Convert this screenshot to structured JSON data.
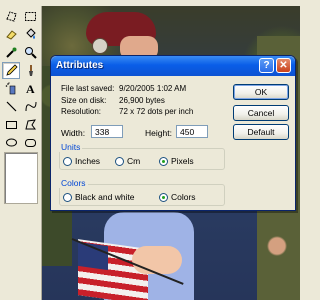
{
  "dialog": {
    "title": "Attributes",
    "help_glyph": "?",
    "close_glyph": "✕",
    "info": [
      {
        "label": "File last saved:",
        "value": "9/20/2005 1:02 AM"
      },
      {
        "label": "Size on disk:",
        "value": "26,900 bytes"
      },
      {
        "label": "Resolution:",
        "value": "72 x 72 dots per inch"
      }
    ],
    "width_label": "Width:",
    "width_value": "338",
    "height_label": "Height:",
    "height_value": "450",
    "buttons": {
      "ok": "OK",
      "cancel": "Cancel",
      "default": "Default"
    },
    "units": {
      "title": "Units",
      "options": [
        "Inches",
        "Cm",
        "Pixels"
      ],
      "selected": "Pixels"
    },
    "colors": {
      "title": "Colors",
      "options": [
        "Black and white",
        "Colors"
      ],
      "selected": "Colors"
    }
  },
  "toolbox": {
    "tools": [
      "free-form-select-icon",
      "select-icon",
      "eraser-icon",
      "fill-with-color-icon",
      "pick-color-icon",
      "magnifier-icon",
      "pencil-icon",
      "brush-icon",
      "airbrush-icon",
      "text-icon",
      "line-icon",
      "curve-icon",
      "rectangle-icon",
      "polygon-icon",
      "ellipse-icon",
      "rounded-rectangle-icon"
    ],
    "active_tool": "pencil-icon"
  },
  "colors_ui": {
    "titlebar": "#0a5ee8",
    "group_title": "#0046d5",
    "dialog_face": "#ece9d8"
  }
}
